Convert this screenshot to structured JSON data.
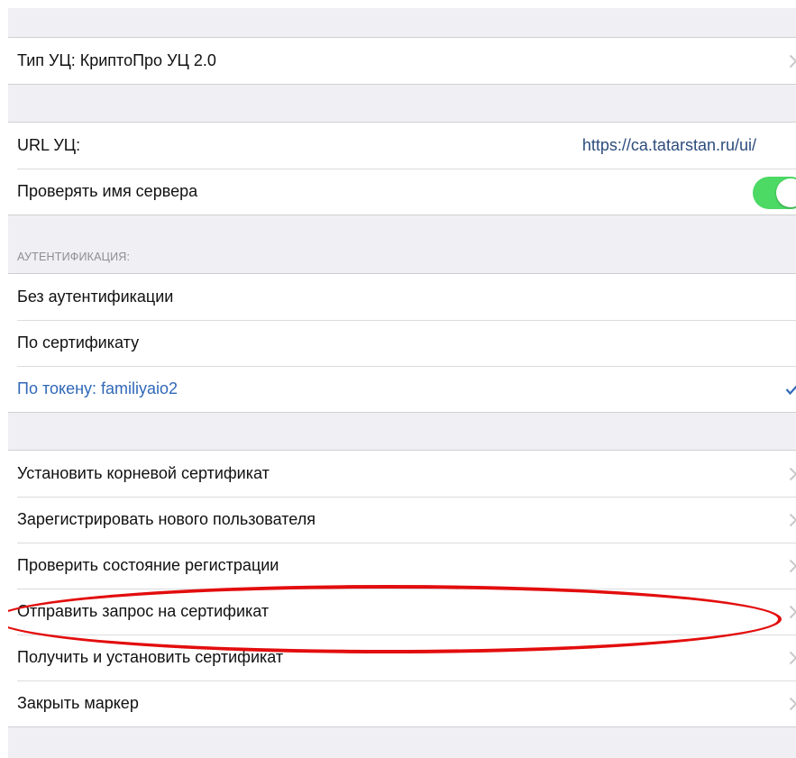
{
  "ca_type": {
    "label": "Тип УЦ: КриптоПро УЦ 2.0"
  },
  "ca_url": {
    "label": "URL УЦ:",
    "value": "https://ca.tatarstan.ru/ui/"
  },
  "check_server_name": {
    "label": "Проверять имя сервера",
    "enabled": true
  },
  "authentication": {
    "header": "АУТЕНТИФИКАЦИЯ:",
    "options": [
      {
        "label": "Без аутентификации",
        "selected": false
      },
      {
        "label": "По сертификату",
        "selected": false
      },
      {
        "label": "По токену: familiyaio2",
        "selected": true
      }
    ]
  },
  "actions": [
    {
      "label": "Установить корневой сертификат"
    },
    {
      "label": "Зарегистрировать нового пользователя"
    },
    {
      "label": "Проверить состояние регистрации"
    },
    {
      "label": "Отправить запрос на сертификат",
      "highlighted": true
    },
    {
      "label": "Получить и установить сертификат"
    },
    {
      "label": "Закрыть маркер"
    }
  ],
  "colors": {
    "accent": "#3068b8",
    "link_value": "#2c4c7c",
    "toggle_on": "#4cd964",
    "highlight_oval": "#e30d0d",
    "group_background": "#efeff4"
  },
  "icons": {
    "disclosure": "chevron-right-icon",
    "selected": "checkmark-icon"
  }
}
